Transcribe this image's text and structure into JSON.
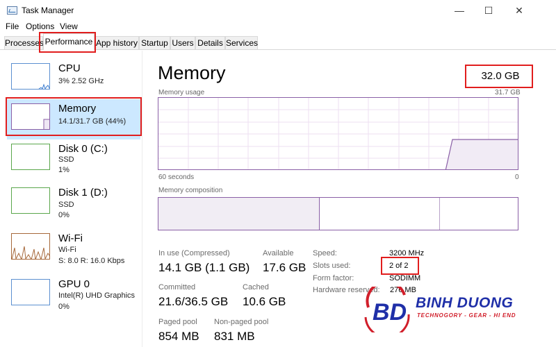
{
  "window": {
    "title": "Task Manager",
    "minimize": "—",
    "maximize": "☐",
    "close": "✕"
  },
  "menu": [
    "File",
    "Options",
    "View"
  ],
  "tabs": [
    "Processes",
    "Performance",
    "App history",
    "Startup",
    "Users",
    "Details",
    "Services"
  ],
  "sidebar": [
    {
      "name": "CPU",
      "sub1": "3%  2.52 GHz",
      "sub2": "",
      "sub3": ""
    },
    {
      "name": "Memory",
      "sub1": "14.1/31.7 GB (44%)",
      "sub2": "",
      "sub3": ""
    },
    {
      "name": "Disk 0 (C:)",
      "sub1": "SSD",
      "sub2": "1%",
      "sub3": ""
    },
    {
      "name": "Disk 1 (D:)",
      "sub1": "SSD",
      "sub2": "0%",
      "sub3": ""
    },
    {
      "name": "Wi-Fi",
      "sub1": "Wi-Fi",
      "sub2": "S: 8.0  R: 16.0 Kbps",
      "sub3": ""
    },
    {
      "name": "GPU 0",
      "sub1": "Intel(R) UHD Graphics",
      "sub2": "0%",
      "sub3": ""
    }
  ],
  "main": {
    "title": "Memory",
    "total": "32.0 GB",
    "usage_label": "Memory usage",
    "usage_max": "31.7 GB",
    "time_left": "60 seconds",
    "time_right": "0",
    "composition_label": "Memory composition",
    "stats": {
      "in_use_label": "In use (Compressed)",
      "in_use_value": "14.1 GB (1.1 GB)",
      "available_label": "Available",
      "available_value": "17.6 GB",
      "committed_label": "Committed",
      "committed_value": "21.6/36.5 GB",
      "cached_label": "Cached",
      "cached_value": "10.6 GB",
      "paged_label": "Paged pool",
      "paged_value": "854 MB",
      "nonpaged_label": "Non-paged pool",
      "nonpaged_value": "831 MB"
    },
    "details": {
      "speed_label": "Speed:",
      "speed_value": "3200 MHz",
      "slots_label": "Slots used:",
      "slots_value": "2 of 2",
      "form_label": "Form factor:",
      "form_value": "SODIMM",
      "hwres_label": "Hardware reserved:",
      "hwres_value": "276 MB"
    }
  },
  "watermark": {
    "brand": "BINH DUONG",
    "tagline": "TECHNOGORY - GEAR - HI END"
  },
  "colors": {
    "memory": "#8a5fa6",
    "cpu": "#5b8fd0",
    "disk": "#5aa64b",
    "wifi": "#a6683a",
    "highlight": "#e11d1d",
    "selected": "#cce8ff"
  }
}
